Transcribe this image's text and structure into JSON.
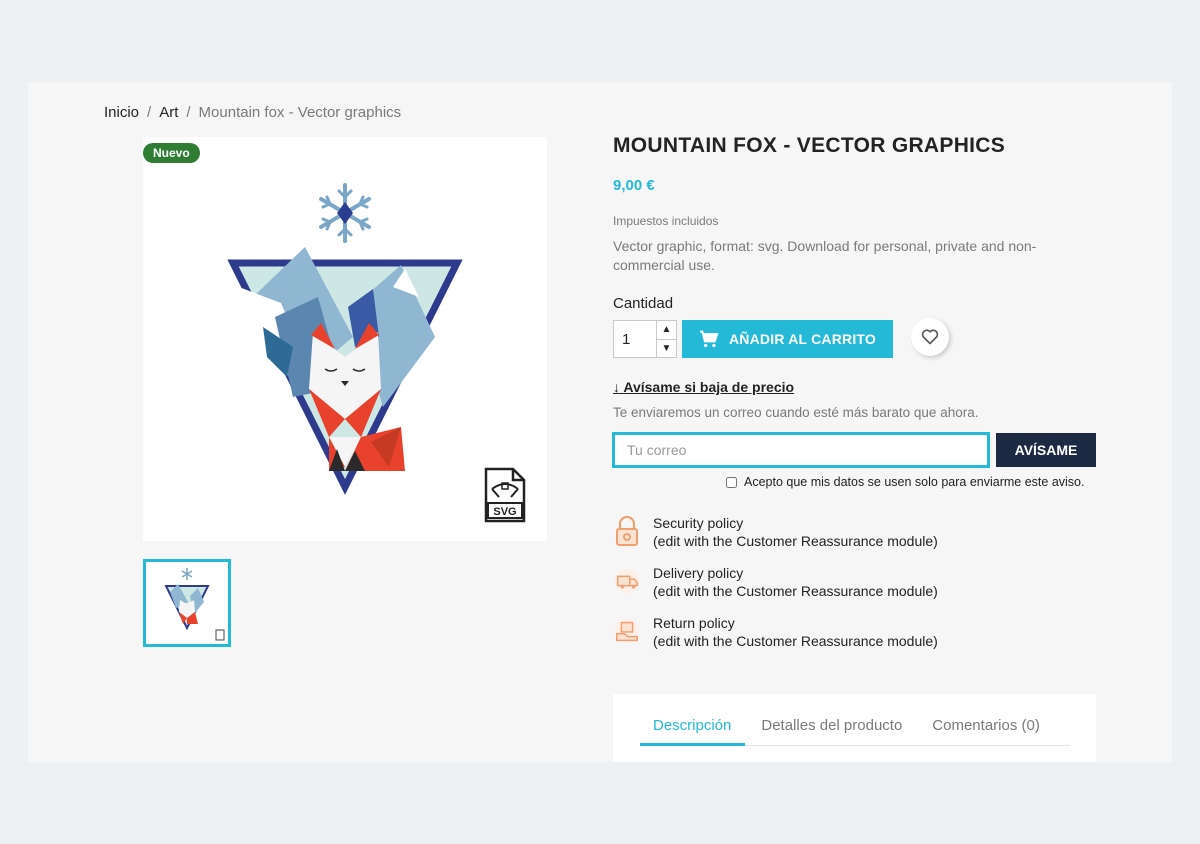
{
  "breadcrumb": {
    "home": "Inicio",
    "category": "Art",
    "current": "Mountain fox - Vector graphics",
    "separator": "/"
  },
  "product": {
    "badge": "Nuevo",
    "title": "MOUNTAIN FOX - VECTOR GRAPHICS",
    "price": "9,00 €",
    "tax_note": "Impuestos incluidos",
    "description": "Vector graphic, format: svg. Download for personal, private and non-commercial use.",
    "svg_label": "SVG"
  },
  "purchase": {
    "quantity_label": "Cantidad",
    "quantity_value": "1",
    "add_to_cart": "AÑADIR AL CARRITO"
  },
  "price_alert": {
    "link": "↓ Avísame si baja de precio",
    "note": "Te enviaremos un correo cuando esté más barato que ahora.",
    "email_placeholder": "Tu correo",
    "button": "AVÍSAME",
    "consent": "Acepto que mis datos se usen solo para enviarme este aviso."
  },
  "reassurance": [
    {
      "title": "Security policy",
      "subtitle": "(edit with the Customer Reassurance module)"
    },
    {
      "title": "Delivery policy",
      "subtitle": "(edit with the Customer Reassurance module)"
    },
    {
      "title": "Return policy",
      "subtitle": "(edit with the Customer Reassurance module)"
    }
  ],
  "tabs": [
    {
      "label": "Descripción"
    },
    {
      "label": "Detalles del producto"
    },
    {
      "label": "Comentarios (0)"
    }
  ],
  "colors": {
    "accent": "#24b9d7",
    "dark_button": "#1d2a44",
    "badge_green": "#2e7d32",
    "fox_red": "#e8412c"
  }
}
